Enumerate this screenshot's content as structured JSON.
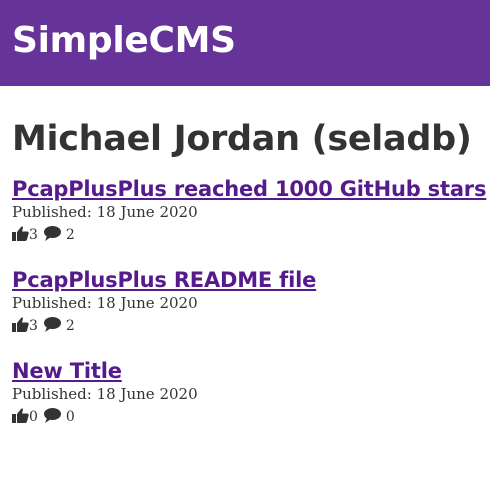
{
  "header": {
    "app_title": "SimpleCMS"
  },
  "main": {
    "page_title": "Michael Jordan (seladb)",
    "posts": [
      {
        "title": "PcapPlusPlus reached 1000 GitHub stars",
        "published": "Published: 18 June 2020",
        "likes": "3",
        "comments": "2"
      },
      {
        "title": "PcapPlusPlus README file",
        "published": "Published: 18 June 2020",
        "likes": "3",
        "comments": "2"
      },
      {
        "title": "New Title",
        "published": "Published: 18 June 2020",
        "likes": "0",
        "comments": "0"
      }
    ]
  },
  "icons": {
    "like": "thumbs-up-icon",
    "comment": "comment-icon"
  },
  "colors": {
    "header_bg": "#663399",
    "link": "#551a8b",
    "text": "#333333"
  }
}
